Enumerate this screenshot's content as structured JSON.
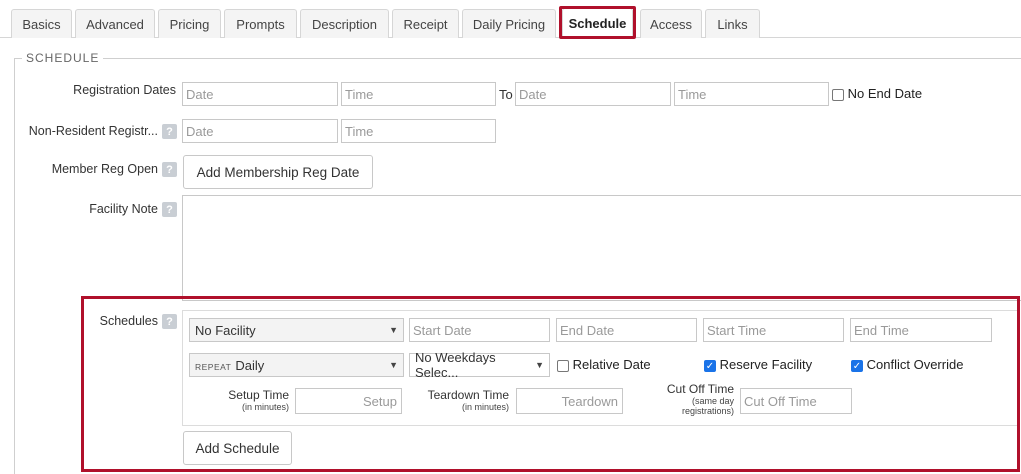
{
  "tabs": [
    {
      "label": "Basics"
    },
    {
      "label": "Advanced"
    },
    {
      "label": "Pricing"
    },
    {
      "label": "Prompts"
    },
    {
      "label": "Description"
    },
    {
      "label": "Receipt"
    },
    {
      "label": "Daily Pricing"
    },
    {
      "label": "Schedule"
    },
    {
      "label": "Access"
    },
    {
      "label": "Links"
    }
  ],
  "section_legend": "SCHEDULE",
  "registration": {
    "label": "Registration Dates",
    "date_placeholder": "Date",
    "time_placeholder": "Time",
    "to_label": "To",
    "end_date_placeholder": "Date",
    "end_time_placeholder": "Time",
    "no_end_date_label": "No End Date"
  },
  "non_resident": {
    "label": "Non-Resident Registr...",
    "help": "?",
    "date_placeholder": "Date",
    "time_placeholder": "Time"
  },
  "member_reg": {
    "label": "Member Reg Open",
    "help": "?",
    "button_label": "Add Membership Reg Date"
  },
  "facility_note": {
    "label": "Facility Note",
    "help": "?"
  },
  "schedules": {
    "label": "Schedules",
    "help": "?",
    "facility_value": "No Facility",
    "start_date_placeholder": "Start Date",
    "end_date_placeholder": "End Date",
    "start_time_placeholder": "Start Time",
    "end_time_placeholder": "End Time",
    "repeat_prefix": "REPEAT",
    "repeat_value": "Daily",
    "weekdays_value": "No Weekdays Selec...",
    "relative_date_label": "Relative Date",
    "relative_date_checked": false,
    "reserve_facility_label": "Reserve Facility",
    "reserve_facility_checked": true,
    "conflict_override_label": "Conflict Override",
    "conflict_override_checked": true,
    "setup_label": "Setup Time",
    "setup_sub": "(in minutes)",
    "setup_placeholder": "Setup",
    "teardown_label": "Teardown Time",
    "teardown_sub": "(in minutes)",
    "teardown_placeholder": "Teardown",
    "cutoff_label": "Cut Off Time",
    "cutoff_sub1": "(same day",
    "cutoff_sub2": "registrations)",
    "cutoff_placeholder": "Cut Off Time",
    "add_button_label": "Add Schedule"
  },
  "colors": {
    "highlight": "#b0102b",
    "checkbox": "#1a73e8"
  }
}
